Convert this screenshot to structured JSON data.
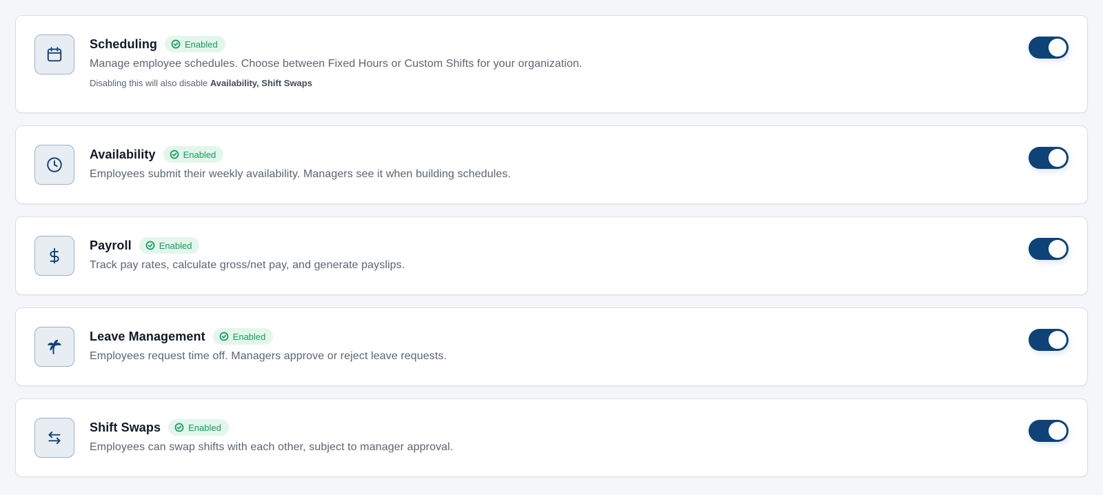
{
  "badge_label": "Enabled",
  "colors": {
    "accent": "#0d4377",
    "enabled_badge_bg": "#e3f6ec",
    "enabled_badge_text": "#159a5b"
  },
  "modules": [
    {
      "title": "Scheduling",
      "icon": "calendar-icon",
      "enabled": true,
      "description": "Manage employee schedules. Choose between Fixed Hours or Custom Shifts for your organization.",
      "note_prefix": "Disabling this will also disable ",
      "note_dependencies": "Availability, Shift Swaps"
    },
    {
      "title": "Availability",
      "icon": "clock-icon",
      "enabled": true,
      "description": "Employees submit their weekly availability. Managers see it when building schedules."
    },
    {
      "title": "Payroll",
      "icon": "dollar-icon",
      "enabled": true,
      "description": "Track pay rates, calculate gross/net pay, and generate payslips."
    },
    {
      "title": "Leave Management",
      "icon": "palm-tree-icon",
      "enabled": true,
      "description": "Employees request time off. Managers approve or reject leave requests."
    },
    {
      "title": "Shift Swaps",
      "icon": "swap-arrows-icon",
      "enabled": true,
      "description": "Employees can swap shifts with each other, subject to manager approval."
    }
  ]
}
